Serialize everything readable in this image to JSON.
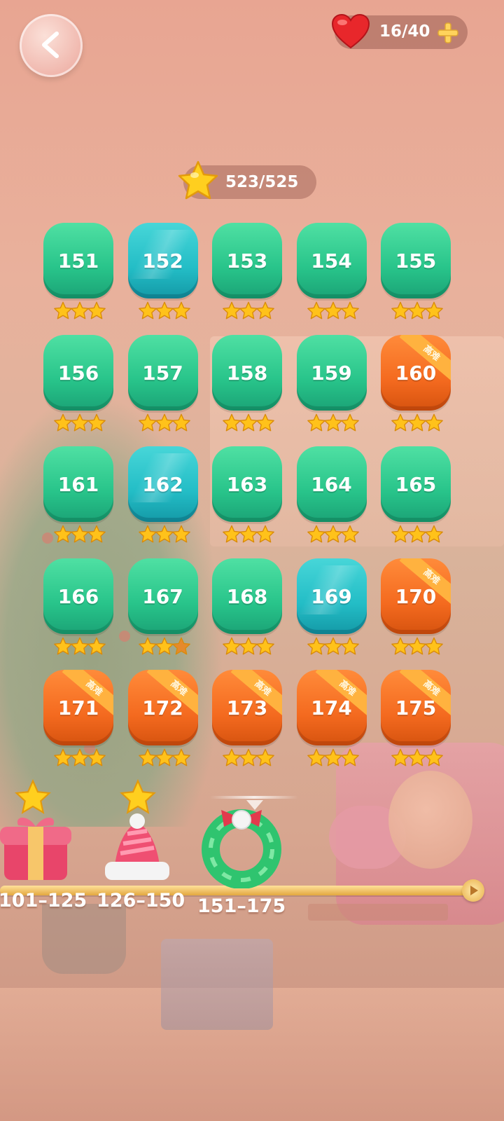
{
  "header": {
    "back_icon": "chevron-left-icon",
    "lives": "16/40",
    "lives_icon": "heart-icon",
    "add_icon": "plus-icon"
  },
  "star_total": "523/525",
  "levels": [
    {
      "num": "151",
      "color": "green",
      "stars": 3,
      "hard": false
    },
    {
      "num": "152",
      "color": "teal",
      "stars": 3,
      "hard": false
    },
    {
      "num": "153",
      "color": "green",
      "stars": 3,
      "hard": false
    },
    {
      "num": "154",
      "color": "green",
      "stars": 3,
      "hard": false
    },
    {
      "num": "155",
      "color": "green",
      "stars": 3,
      "hard": false
    },
    {
      "num": "156",
      "color": "green",
      "stars": 3,
      "hard": false
    },
    {
      "num": "157",
      "color": "green",
      "stars": 3,
      "hard": false
    },
    {
      "num": "158",
      "color": "green",
      "stars": 3,
      "hard": false
    },
    {
      "num": "159",
      "color": "green",
      "stars": 3,
      "hard": false
    },
    {
      "num": "160",
      "color": "orange",
      "stars": 3,
      "hard": true
    },
    {
      "num": "161",
      "color": "green",
      "stars": 3,
      "hard": false
    },
    {
      "num": "162",
      "color": "teal",
      "stars": 3,
      "hard": false
    },
    {
      "num": "163",
      "color": "green",
      "stars": 3,
      "hard": false
    },
    {
      "num": "164",
      "color": "green",
      "stars": 3,
      "hard": false
    },
    {
      "num": "165",
      "color": "green",
      "stars": 3,
      "hard": false
    },
    {
      "num": "166",
      "color": "green",
      "stars": 3,
      "hard": false
    },
    {
      "num": "167",
      "color": "green",
      "stars": 2,
      "hard": false
    },
    {
      "num": "168",
      "color": "green",
      "stars": 3,
      "hard": false
    },
    {
      "num": "169",
      "color": "teal",
      "stars": 3,
      "hard": false
    },
    {
      "num": "170",
      "color": "orange",
      "stars": 3,
      "hard": true
    },
    {
      "num": "171",
      "color": "orange",
      "stars": 3,
      "hard": true
    },
    {
      "num": "172",
      "color": "orange",
      "stars": 3,
      "hard": true
    },
    {
      "num": "173",
      "color": "orange",
      "stars": 3,
      "hard": true
    },
    {
      "num": "174",
      "color": "orange",
      "stars": 3,
      "hard": true
    },
    {
      "num": "175",
      "color": "orange",
      "stars": 3,
      "hard": true
    }
  ],
  "hard_label": "高难",
  "chapters": [
    {
      "label": "101–125",
      "icon": "gift-icon",
      "starred": true
    },
    {
      "label": "126–150",
      "icon": "santa-hat-icon",
      "starred": true
    },
    {
      "label": "151–175",
      "icon": "wreath-icon",
      "starred": false
    }
  ],
  "colors": {
    "green": "#28c48a",
    "teal": "#23bdc6",
    "orange": "#f46a1f",
    "star": "#ffc21a"
  }
}
